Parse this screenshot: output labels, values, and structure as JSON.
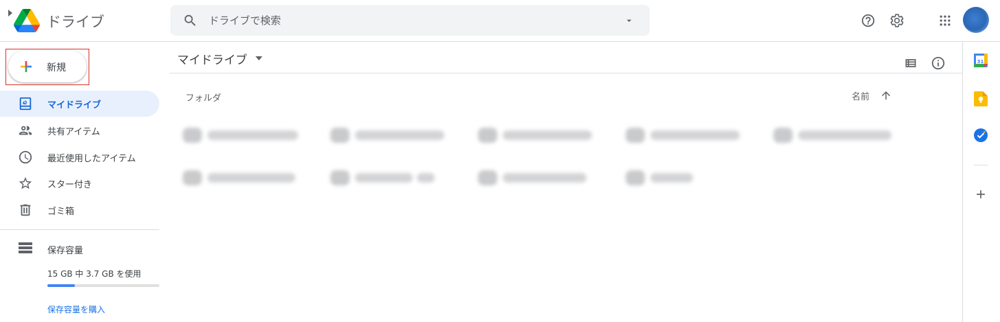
{
  "app": {
    "title": "ドライブ",
    "logo_icon": "google-drive-logo"
  },
  "header": {
    "search_placeholder": "ドライブで検索",
    "icons": [
      "search-icon",
      "search-options-icon",
      "help-icon",
      "settings-icon",
      "apps-grid-icon",
      "avatar"
    ]
  },
  "sidebar": {
    "new_label": "新規",
    "items": [
      {
        "label": "マイドライブ",
        "icon": "my-drive-icon",
        "active": true
      },
      {
        "label": "共有アイテム",
        "icon": "shared-icon"
      },
      {
        "label": "最近使用したアイテム",
        "icon": "recent-icon"
      },
      {
        "label": "スター付き",
        "icon": "star-icon"
      },
      {
        "label": "ゴミ箱",
        "icon": "trash-icon"
      }
    ],
    "storage": {
      "label": "保存容量",
      "usage_text": "15 GB 中 3.7 GB を使用",
      "used_fraction": 0.247,
      "buy_label": "保存容量を購入"
    }
  },
  "main": {
    "title": "マイドライブ",
    "section_label": "フォルダ",
    "sort_label": "名前",
    "folder_count": 9
  },
  "right_rail": {
    "icons": [
      "calendar-icon",
      "keep-icon",
      "tasks-icon",
      "add-addon-icon"
    ],
    "calendar_day": "31"
  },
  "colors": {
    "accent": "#1a73e8",
    "active_bg": "#e8f0fe",
    "active_text": "#1967d2",
    "highlight_border": "#d93025",
    "google_blue": "#4285f4",
    "google_red": "#ea4335",
    "google_yellow": "#fbbc04",
    "google_green": "#34a853"
  }
}
